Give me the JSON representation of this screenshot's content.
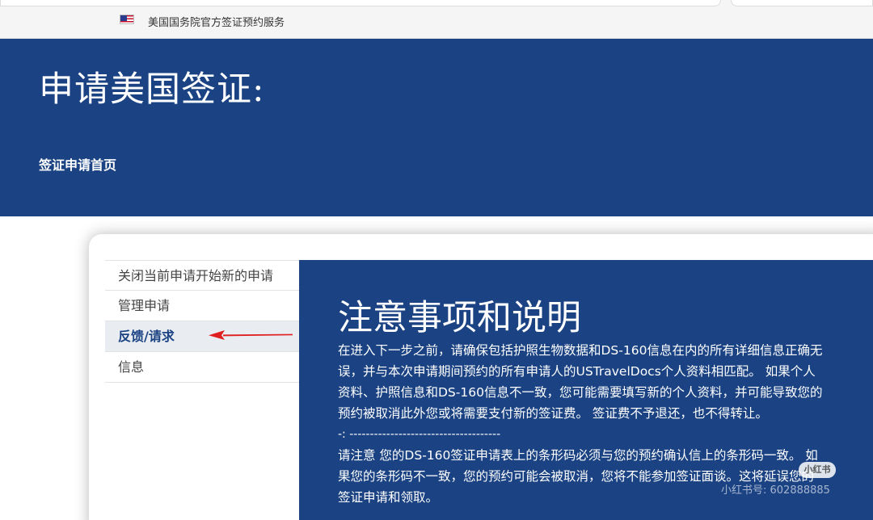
{
  "topbar": {
    "flag_icon": "us-flag-icon",
    "site_name": "美国国务院官方签证预约服务"
  },
  "hero": {
    "title": "申请美国签证:",
    "subtitle": "签证申请首页"
  },
  "sidebar": {
    "items": [
      {
        "label": "关闭当前申请开始新的申请",
        "active": false
      },
      {
        "label": "管理申请",
        "active": false
      },
      {
        "label": "反馈/请求",
        "active": true
      },
      {
        "label": "信息",
        "active": false
      }
    ],
    "annotation": "red-arrow-icon"
  },
  "notice": {
    "title": "注意事项和说明",
    "paragraph1": "在进入下一步之前，请确保包括护照生物数据和DS-160信息在内的所有详细信息正确无误，并与本次申请期间预约的所有申请人的USTravelDocs个人资料相匹配。 如果个人资料、护照信息和DS-160信息不一致，您可能需要填写新的个人资料，并可能导致您的预约被取消此外您或将需要支付新的签证费。 签证费不予退还，也不得转让。",
    "divider": "-: -------------------------------------",
    "paragraph2": "请注意 您的DS-160签证申请表上的条形码必须与您的预约确认信上的条形码一致。 如果您的条形码不一致，您的预约可能会被取消，您将不能参加签证面谈。这将延误您的签证申请和领取。"
  },
  "watermark": {
    "badge": "小红书",
    "id_text": "小红书号: 602888885"
  },
  "colors": {
    "brand_blue": "#1b4383",
    "arrow_red": "#e02020",
    "active_bg": "#e9edf2"
  }
}
